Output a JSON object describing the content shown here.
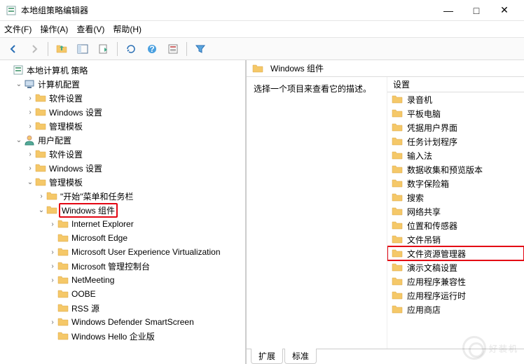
{
  "window": {
    "title": "本地组策略编辑器",
    "min": "—",
    "max": "□",
    "close": "✕"
  },
  "menu": {
    "file": "文件(F)",
    "action": "操作(A)",
    "view": "查看(V)",
    "help": "帮助(H)"
  },
  "toolbar_icons": {
    "back": "arrow-left",
    "fwd": "arrow-right",
    "up": "up",
    "showhide": "panel",
    "export": "export",
    "refresh": "refresh",
    "help2": "help",
    "props": "props",
    "filter": "funnel"
  },
  "tree": {
    "root": "本地计算机 策略",
    "computer_config": "计算机配置",
    "cc_software": "软件设置",
    "cc_windows": "Windows 设置",
    "cc_admin": "管理模板",
    "user_config": "用户配置",
    "uc_software": "软件设置",
    "uc_windows": "Windows 设置",
    "uc_admin": "管理模板",
    "start_menu": "\"开始\"菜单和任务栏",
    "windows_components": "Windows 组件",
    "ie": "Internet Explorer",
    "edge": "Microsoft Edge",
    "muev": "Microsoft User Experience Virtualization",
    "mmc": "Microsoft 管理控制台",
    "netmeeting": "NetMeeting",
    "oobe": "OOBE",
    "rss": "RSS 源",
    "defender_ss": "Windows Defender SmartScreen",
    "hello": "Windows Hello 企业版"
  },
  "right": {
    "header": "Windows 组件",
    "desc_prompt": "选择一个项目来查看它的描述。",
    "col_setting": "设置",
    "items": [
      "录音机",
      "平板电脑",
      "凭据用户界面",
      "任务计划程序",
      "输入法",
      "数据收集和预览版本",
      "数字保险箱",
      "搜索",
      "网络共享",
      "位置和传感器",
      "文件吊销",
      "文件资源管理器",
      "演示文稿设置",
      "应用程序兼容性",
      "应用程序运行时",
      "应用商店"
    ],
    "highlight_index": 11
  },
  "tabs": {
    "extended": "扩展",
    "standard": "标准"
  },
  "watermark": "好装机"
}
